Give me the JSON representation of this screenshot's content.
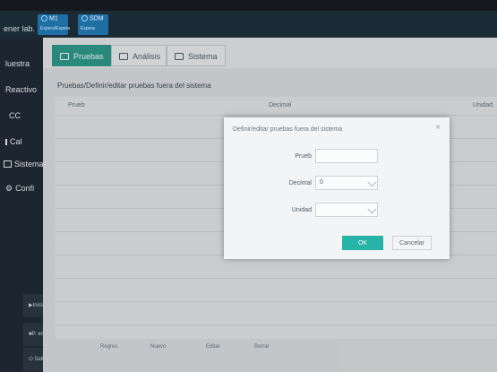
{
  "app": {
    "title": "ener lab."
  },
  "modules": [
    {
      "name": "M1",
      "status": "Espera/Espera"
    },
    {
      "name": "SDM",
      "status": "Espera"
    }
  ],
  "sidebar": {
    "items": [
      {
        "label": "luestra"
      },
      {
        "label": "Reactivo"
      },
      {
        "label": "CC"
      },
      {
        "label": "Cal"
      },
      {
        "label": "Sistema"
      },
      {
        "label": "Confi"
      }
    ],
    "bottom_buttons": [
      {
        "label": "Iniciar"
      },
      {
        "label": "P. eme"
      },
      {
        "label": "Salir"
      }
    ]
  },
  "tabs": [
    {
      "label": "Pruebas",
      "active": true
    },
    {
      "label": "Análisis",
      "active": false
    },
    {
      "label": "Sistema",
      "active": false
    }
  ],
  "breadcrumb": "Pruebas/Definir/editar pruebas fuera del sistema",
  "table": {
    "columns": [
      "Prueb",
      "Decimal",
      "Unidad"
    ]
  },
  "footer": {
    "buttons": [
      "Regres",
      "Nuevo",
      "Editar",
      "Borrar"
    ]
  },
  "modal": {
    "title": "Definir/editar pruebas fuera del sistema",
    "fields": {
      "prueba_label": "Prueb",
      "prueba_value": "",
      "decimal_label": "Decimal",
      "decimal_value": "0",
      "unidad_label": "Unidad",
      "unidad_value": ""
    },
    "ok_label": "OK",
    "cancel_label": "Cancelar"
  },
  "colors": {
    "accent": "#2f9d8d",
    "ok_button": "#27b3a6",
    "module_badge": "#1f6fa4"
  }
}
